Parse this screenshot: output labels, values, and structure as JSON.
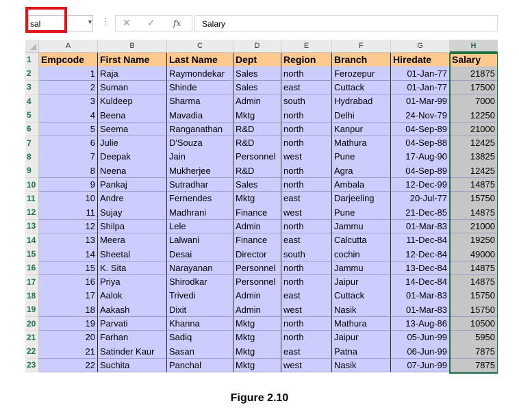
{
  "name_box": {
    "value": "sal"
  },
  "formula_bar": {
    "cancel_symbol": "✕",
    "enter_symbol": "✓",
    "fx_label": "fx",
    "value": "Salary"
  },
  "column_headers": [
    "A",
    "B",
    "C",
    "D",
    "E",
    "F",
    "G",
    "H"
  ],
  "selected_column": "H",
  "row_headers": [
    "1",
    "2",
    "3",
    "4",
    "5",
    "6",
    "7",
    "8",
    "9",
    "10",
    "11",
    "12",
    "13",
    "14",
    "15",
    "16",
    "17",
    "18",
    "19",
    "20",
    "21",
    "22",
    "23"
  ],
  "table": {
    "headers": [
      "Empcode",
      "First Name",
      "Last Name",
      "Dept",
      "Region",
      "Branch",
      "Hiredate",
      "Salary"
    ],
    "rows": [
      [
        "1",
        "Raja",
        "Raymondekar",
        "Sales",
        "north",
        "Ferozepur",
        "01-Jan-77",
        "21875"
      ],
      [
        "2",
        "Suman",
        "Shinde",
        "Sales",
        "east",
        "Cuttack",
        "01-Jan-77",
        "17500"
      ],
      [
        "3",
        "Kuldeep",
        "Sharma",
        "Admin",
        "south",
        "Hydrabad",
        "01-Mar-99",
        "7000"
      ],
      [
        "4",
        "Beena",
        "Mavadia",
        "Mktg",
        "north",
        "Delhi",
        "24-Nov-79",
        "12250"
      ],
      [
        "5",
        "Seema",
        "Ranganathan",
        "R&D",
        "north",
        "Kanpur",
        "04-Sep-89",
        "21000"
      ],
      [
        "6",
        "Julie",
        "D'Souza",
        "R&D",
        "north",
        "Mathura",
        "04-Sep-88",
        "12425"
      ],
      [
        "7",
        "Deepak",
        "Jain",
        "Personnel",
        "west",
        "Pune",
        "17-Aug-90",
        "13825"
      ],
      [
        "8",
        "Neena",
        "Mukherjee",
        "R&D",
        "north",
        "Agra",
        "04-Sep-89",
        "12425"
      ],
      [
        "9",
        "Pankaj",
        "Sutradhar",
        "Sales",
        "north",
        "Ambala",
        "12-Dec-99",
        "14875"
      ],
      [
        "10",
        "Andre",
        "Fernendes",
        "Mktg",
        "east",
        "Darjeeling",
        "20-Jul-77",
        "15750"
      ],
      [
        "11",
        "Sujay",
        "Madhrani",
        "Finance",
        "west",
        "Pune",
        "21-Dec-85",
        "14875"
      ],
      [
        "12",
        "Shilpa",
        "Lele",
        "Admin",
        "north",
        "Jammu",
        "01-Mar-83",
        "21000"
      ],
      [
        "13",
        "Meera",
        "Lalwani",
        "Finance",
        "east",
        "Calcutta",
        "11-Dec-84",
        "19250"
      ],
      [
        "14",
        "Sheetal",
        "Desai",
        "Director",
        "south",
        "cochin",
        "12-Dec-84",
        "49000"
      ],
      [
        "15",
        "K. Sita",
        "Narayanan",
        "Personnel",
        "north",
        "Jammu",
        "13-Dec-84",
        "14875"
      ],
      [
        "16",
        "Priya",
        "Shirodkar",
        "Personnel",
        "north",
        "Jaipur",
        "14-Dec-84",
        "14875"
      ],
      [
        "17",
        "Aalok",
        "Trivedi",
        "Admin",
        "east",
        "Cuttack",
        "01-Mar-83",
        "15750"
      ],
      [
        "18",
        "Aakash",
        "Dixit",
        "Admin",
        "west",
        "Nasik",
        "01-Mar-83",
        "15750"
      ],
      [
        "19",
        "Parvati",
        "Khanna",
        "Mktg",
        "north",
        "Mathura",
        "13-Aug-86",
        "10500"
      ],
      [
        "20",
        "Farhan",
        "Sadiq",
        "Mktg",
        "north",
        "Jaipur",
        "05-Jun-99",
        "5950"
      ],
      [
        "21",
        "Satinder Kaur",
        "Sasan",
        "Mktg",
        "east",
        "Patna",
        "06-Jun-99",
        "7875"
      ],
      [
        "22",
        "Suchita",
        "Panchal",
        "Mktg",
        "west",
        "Nasik",
        "07-Jun-99",
        "7875"
      ]
    ]
  },
  "caption": "Figure 2.10",
  "colors": {
    "data_fill": "#ccccfe",
    "header_fill": "#fdc98f",
    "selected_fill": "#c6c6c6",
    "excel_green": "#217346",
    "highlight_red": "#e0141b"
  }
}
